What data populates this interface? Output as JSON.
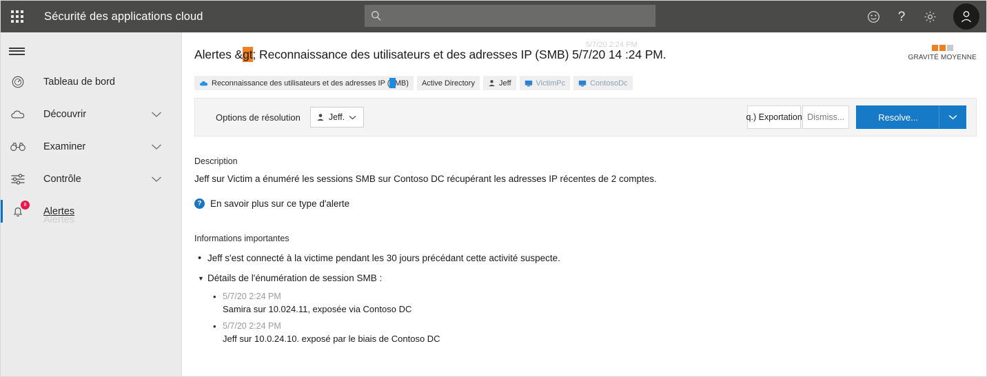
{
  "topbar": {
    "waffle_name": "app-launcher",
    "title": "Sécurité des applications cloud",
    "search_placeholder": "",
    "search_value": "",
    "icons": [
      "smiley-icon",
      "help-icon",
      "gear-icon",
      "account-icon"
    ],
    "help_glyph": "?"
  },
  "sidebar": {
    "items": [
      {
        "label": "Tableau de bord",
        "icon": "gauge-icon",
        "chevron": "",
        "active": false
      },
      {
        "label": "Découvrir",
        "icon": "cloud-icon",
        "chevron": "⌄",
        "active": false
      },
      {
        "label": "Examiner",
        "icon": "binoculars-icon",
        "chevron": "⌄",
        "active": false
      },
      {
        "label": "Contrôle",
        "icon": "sliders-icon",
        "chevron": "⌄",
        "active": false
      },
      {
        "label": "Alertes",
        "icon": "bell-icon",
        "chevron": "",
        "active": true,
        "badge": "8"
      }
    ],
    "ghost_label": "Alertes"
  },
  "page": {
    "title_prefix": "Alertes &",
    "title_highlight": "gt",
    "title_semicolon": ";",
    "title_rest": " Reconnaissance des utilisateurs et des adresses IP (SMB) 5/7/20 14 :24 PM.",
    "title_ghost": "5/7/20 2:24 PM",
    "severity_label": "GRAVITÉ MOYENNE",
    "severity_filled": 2,
    "severity_total": 3,
    "severity_color": "#ef8024"
  },
  "chips": [
    {
      "label": "Reconnaissance des utilisateurs et des adresses IP (SMB)",
      "icon": "cloud-icon",
      "dim": false
    },
    {
      "label": "Active Directory",
      "icon": "",
      "dim": false
    },
    {
      "label": "Jeff",
      "icon": "user-icon",
      "dim": false
    },
    {
      "label": "VictimPc",
      "icon": "computer-icon",
      "dim": true
    },
    {
      "label": "ContosoDc",
      "icon": "computer-icon",
      "dim": true
    }
  ],
  "resolution": {
    "label": "Options de résolution",
    "assignee": "Jeff.",
    "assignee_icon": "user-icon",
    "chevron": "⌄",
    "export_label": "q.) Exportation",
    "dismiss_label": "Dismiss...",
    "resolve_label": "Resolve...",
    "resolve_chevron": "⌄",
    "primary_color": "#167ac6"
  },
  "description": {
    "heading": "Description",
    "text": "Jeff sur Victim a énuméré les sessions SMB sur Contoso DC récupérant les adresses IP récentes de 2 comptes.",
    "learn_more": "En savoir plus sur ce type d'alerte",
    "learn_more_icon": "help-circle-icon"
  },
  "important": {
    "heading": "Informations importantes",
    "bullets": [
      {
        "marker": "•",
        "text": "Jeff s'est connecté à la victime pendant les 30 jours précédant cette activité suspecte."
      },
      {
        "marker": "▼",
        "text": "Détails de l'énumération de session SMB :",
        "children": [
          {
            "time": "5/7/20 2:24 PM",
            "desc": "Samira sur 10.024.11, exposée via Contoso DC"
          },
          {
            "time": "5/7/20 2:24 PM",
            "desc": "Jeff sur 10.0.24.10. exposé par le biais de Contoso DC"
          }
        ]
      }
    ]
  }
}
